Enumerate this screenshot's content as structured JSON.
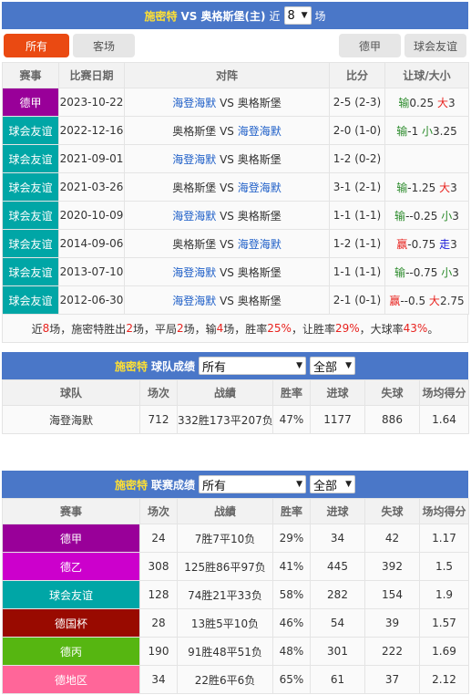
{
  "h2h": {
    "team": "施密特",
    "vs_text": "VS 奥格斯堡(主)",
    "recent_label": "近",
    "recent_count": "8",
    "unit_label": "场",
    "filters_left": [
      "所有",
      "客场"
    ],
    "filters_right": [
      "德甲",
      "球会友谊"
    ],
    "active_filter": "所有",
    "columns": [
      "赛事",
      "比赛日期",
      "对阵",
      "比分",
      "让球/大小"
    ],
    "rows": [
      {
        "league": "德甲",
        "league_color": "#990099",
        "date": "2023-10-22",
        "home": "海登海默",
        "home_hl": true,
        "vs": "VS",
        "away": "奥格斯堡",
        "away_hl": false,
        "score": "2-5 (2-3)",
        "hc_result": "输",
        "hc_result_color": "green",
        "hc_value": "0.25",
        "ou_result": "大",
        "ou_result_color": "red",
        "ou_value": "3"
      },
      {
        "league": "球会友谊",
        "league_color": "#00a6a6",
        "date": "2022-12-16",
        "home": "奥格斯堡",
        "home_hl": false,
        "vs": "VS",
        "away": "海登海默",
        "away_hl": true,
        "score": "2-0 (1-0)",
        "hc_result": "输",
        "hc_result_color": "green",
        "hc_value": "-1",
        "ou_result": "小",
        "ou_result_color": "green",
        "ou_value": "3.25"
      },
      {
        "league": "球会友谊",
        "league_color": "#00a6a6",
        "date": "2021-09-01",
        "home": "海登海默",
        "home_hl": true,
        "vs": "VS",
        "away": "奥格斯堡",
        "away_hl": false,
        "score": "1-2 (0-2)",
        "hc_result": "",
        "hc_result_color": "green",
        "hc_value": "",
        "ou_result": "",
        "ou_result_color": "red",
        "ou_value": ""
      },
      {
        "league": "球会友谊",
        "league_color": "#00a6a6",
        "date": "2021-03-26",
        "home": "奥格斯堡",
        "home_hl": false,
        "vs": "VS",
        "away": "海登海默",
        "away_hl": true,
        "score": "3-1 (2-1)",
        "hc_result": "输",
        "hc_result_color": "green",
        "hc_value": "-1.25",
        "ou_result": "大",
        "ou_result_color": "red",
        "ou_value": "3"
      },
      {
        "league": "球会友谊",
        "league_color": "#00a6a6",
        "date": "2020-10-09",
        "home": "海登海默",
        "home_hl": true,
        "vs": "VS",
        "away": "奥格斯堡",
        "away_hl": false,
        "score": "1-1 (1-1)",
        "hc_result": "输",
        "hc_result_color": "green",
        "hc_value": "--0.25",
        "ou_result": "小",
        "ou_result_color": "green",
        "ou_value": "3"
      },
      {
        "league": "球会友谊",
        "league_color": "#00a6a6",
        "date": "2014-09-06",
        "home": "奥格斯堡",
        "home_hl": false,
        "vs": "VS",
        "away": "海登海默",
        "away_hl": true,
        "score": "1-2 (1-1)",
        "hc_result": "赢",
        "hc_result_color": "red",
        "hc_value": "-0.75",
        "ou_result": "走",
        "ou_result_color": "navy",
        "ou_value": "3"
      },
      {
        "league": "球会友谊",
        "league_color": "#00a6a6",
        "date": "2013-07-10",
        "home": "海登海默",
        "home_hl": true,
        "vs": "VS",
        "away": "奥格斯堡",
        "away_hl": false,
        "score": "1-1 (1-1)",
        "hc_result": "输",
        "hc_result_color": "green",
        "hc_value": "--0.75",
        "ou_result": "小",
        "ou_result_color": "green",
        "ou_value": "3"
      },
      {
        "league": "球会友谊",
        "league_color": "#00a6a6",
        "date": "2012-06-30",
        "home": "海登海默",
        "home_hl": true,
        "vs": "VS",
        "away": "奥格斯堡",
        "away_hl": false,
        "score": "2-1 (0-1)",
        "hc_result": "赢",
        "hc_result_color": "red",
        "hc_value": "--0.5",
        "ou_result": "大",
        "ou_result_color": "red",
        "ou_value": "2.75"
      }
    ],
    "summary": {
      "p1": "近",
      "n1": "8",
      "p2": "场，施密特胜出",
      "n2": "2",
      "p3": "场，平局",
      "n3": "2",
      "p4": "场，输",
      "n4": "4",
      "p5": "场，胜率",
      "n5": "25%",
      "p6": "，让胜率",
      "n6": "29%",
      "p7": "，大球率",
      "n7": "43%",
      "p8": "。"
    }
  },
  "team_record": {
    "team": "施密特",
    "title": "球队成绩",
    "select1": "所有",
    "select2": "全部",
    "columns": [
      "球队",
      "场次",
      "战績",
      "胜率",
      "进球",
      "失球",
      "场均得分"
    ],
    "rows": [
      {
        "name": "海登海默",
        "played": "712",
        "record": "332胜173平207负",
        "win_rate": "47%",
        "goals_for": "1177",
        "goals_against": "886",
        "avg_points": "1.64"
      }
    ]
  },
  "league_record": {
    "team": "施密特",
    "title": "联赛成绩",
    "select1": "所有",
    "select2": "全部",
    "columns": [
      "赛事",
      "场次",
      "战績",
      "胜率",
      "进球",
      "失球",
      "场均得分"
    ],
    "rows": [
      {
        "name": "德甲",
        "color": "#990099",
        "played": "24",
        "record": "7胜7平10负",
        "win_rate": "29%",
        "goals_for": "34",
        "goals_against": "42",
        "avg_points": "1.17"
      },
      {
        "name": "德乙",
        "color": "#cc00cc",
        "played": "308",
        "record": "125胜86平97负",
        "win_rate": "41%",
        "goals_for": "445",
        "goals_against": "392",
        "avg_points": "1.5"
      },
      {
        "name": "球会友谊",
        "color": "#00a6a6",
        "played": "128",
        "record": "74胜21平33负",
        "win_rate": "58%",
        "goals_for": "282",
        "goals_against": "154",
        "avg_points": "1.9"
      },
      {
        "name": "德国杯",
        "color": "#990a00",
        "played": "28",
        "record": "13胜5平10负",
        "win_rate": "46%",
        "goals_for": "54",
        "goals_against": "39",
        "avg_points": "1.57"
      },
      {
        "name": "德丙",
        "color": "#56b611",
        "played": "190",
        "record": "91胜48平51负",
        "win_rate": "48%",
        "goals_for": "301",
        "goals_against": "222",
        "avg_points": "1.69"
      },
      {
        "name": "德地区",
        "color": "#ff6699",
        "played": "34",
        "record": "22胜6平6负",
        "win_rate": "65%",
        "goals_for": "61",
        "goals_against": "37",
        "avg_points": "2.12"
      }
    ]
  }
}
